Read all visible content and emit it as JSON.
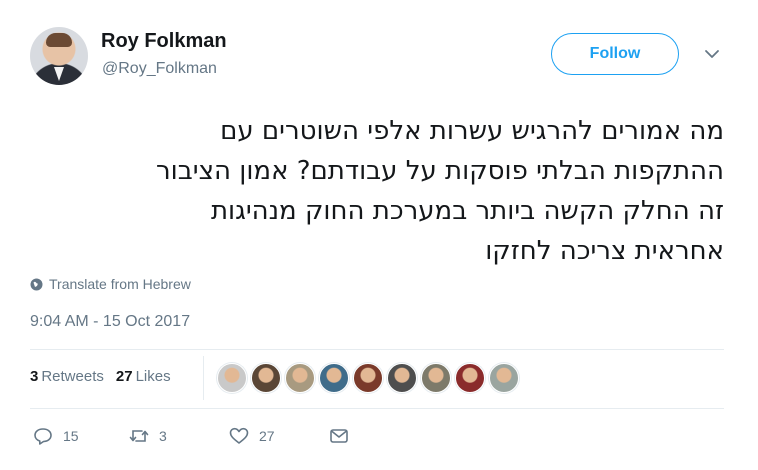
{
  "user": {
    "name": "Roy Folkman",
    "handle": "@Roy_Folkman",
    "follow_label": "Follow"
  },
  "tweet": {
    "lines": [
      "מה אמורים להרגיש עשרות אלפי השוטרים עם",
      "ההתקפות הבלתי פוסקות על עבודתם? אמון הציבור",
      "זה החלק הקשה ביותר במערכת החוק מנהיגות",
      "אחראית צריכה לחזקו"
    ],
    "translate_label": "Translate from Hebrew",
    "timestamp": "9:04 AM - 15 Oct 2017"
  },
  "stats": {
    "retweets_count": "3",
    "retweets_label": "Retweets",
    "likes_count": "27",
    "likes_label": "Likes"
  },
  "liker_avatars": [
    {
      "color": "#c9c9c9"
    },
    {
      "color": "#5a4636"
    },
    {
      "color": "#a89a80"
    },
    {
      "color": "#3f6c8a"
    },
    {
      "color": "#7a3a2a"
    },
    {
      "color": "#4e4e4e"
    },
    {
      "color": "#7d7a6a"
    },
    {
      "color": "#8a2b2b"
    },
    {
      "color": "#9aa5a0"
    }
  ],
  "actions": {
    "replies": "15",
    "retweets": "3",
    "likes": "27"
  },
  "colors": {
    "accent": "#1da1f2",
    "muted": "#657786",
    "divider": "#e6ecf0"
  }
}
